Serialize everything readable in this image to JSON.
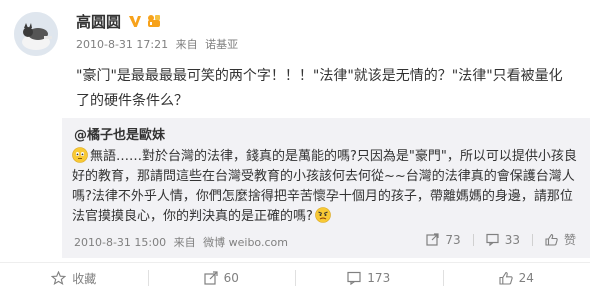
{
  "post": {
    "author": "高圆圆",
    "time": "2010-8-31 17:21",
    "source_prefix": "来自",
    "source": "诺基亚",
    "text": "\"豪门\"是最最最最可笑的两个字！！！\"法律\"就该是无情的？\"法律\"只看被量化了的硬件条件么？"
  },
  "repost": {
    "author": "@橘子也是歐妹",
    "text": "無語……對於台灣的法律，錢真的是萬能的嗎?只因為是\"豪門\"，所以可以提供小孩良好的教育，那請問這些在台灣受教育的小孩該何去何從~~台灣的法律真的會保護台灣人嗎?法律不外乎人情，你們怎麼捨得把辛苦懷孕十個月的孩子，帶離媽媽的身邊，請那位法官摸摸良心，你的判決真的是正確的嗎?",
    "time": "2010-8-31 15:00",
    "source_prefix": "来自",
    "source": "微博 weibo.com",
    "reposts": "73",
    "comments": "33",
    "likes_label": "赞"
  },
  "actions": {
    "collect": "收藏",
    "repost": "60",
    "comment": "173",
    "like": "24"
  },
  "colors": {
    "accent_orange": "#f7a21b",
    "text": "#333333",
    "meta": "#808080",
    "repost_bg": "#f2f2f5"
  },
  "icons": {
    "verified": "verified-v-icon",
    "level": "member-level-icon",
    "emoji_speechless": "speechless-emoji-icon",
    "emoji_angry": "angry-emoji-icon"
  }
}
